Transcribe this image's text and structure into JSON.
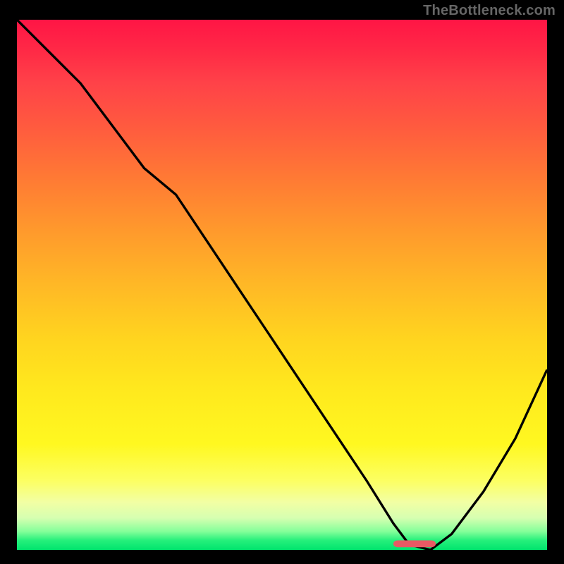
{
  "watermark": "TheBottleneck.com",
  "colors": {
    "frame_bg": "#000000",
    "watermark": "#666666",
    "curve_stroke": "#000000",
    "marker_fill": "#e85a64",
    "gradient_top": "#ff1545",
    "gradient_bottom": "#00e46e"
  },
  "chart_data": {
    "type": "line",
    "title": "",
    "xlabel": "",
    "ylabel": "",
    "xlim": [
      0,
      100
    ],
    "ylim": [
      0,
      100
    ],
    "grid": false,
    "series": [
      {
        "name": "bottleneck-curve",
        "x": [
          0,
          6,
          12,
          18,
          24,
          30,
          36,
          42,
          48,
          54,
          60,
          66,
          71,
          74,
          78,
          82,
          88,
          94,
          100
        ],
        "y": [
          100,
          94,
          88,
          80,
          72,
          67,
          58,
          49,
          40,
          31,
          22,
          13,
          5,
          1,
          0,
          3,
          11,
          21,
          34
        ]
      }
    ],
    "marker": {
      "name": "optimum-range",
      "shape": "rounded-bar",
      "x_start": 71,
      "x_end": 79,
      "y": 0.6,
      "color": "#e85a64"
    },
    "background": {
      "type": "vertical-gradient",
      "stops": [
        {
          "pos": 0.0,
          "color": "#ff1545"
        },
        {
          "pos": 0.3,
          "color": "#ff7a34"
        },
        {
          "pos": 0.6,
          "color": "#ffd41f"
        },
        {
          "pos": 0.85,
          "color": "#fcff63"
        },
        {
          "pos": 0.95,
          "color": "#85ff9a"
        },
        {
          "pos": 1.0,
          "color": "#00e46e"
        }
      ]
    }
  }
}
